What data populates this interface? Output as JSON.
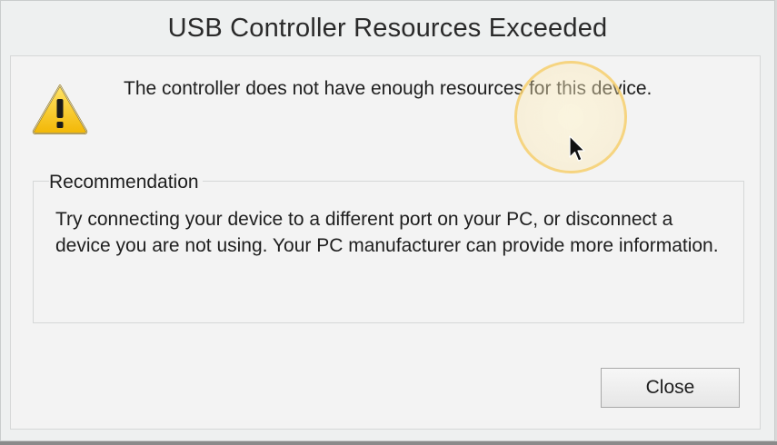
{
  "dialog": {
    "title": "USB Controller Resources Exceeded",
    "message": "The controller does not have enough resources for this device.",
    "recommendation": {
      "heading": "Recommendation",
      "body": "Try connecting your device to a different port on your PC, or disconnect a device you are not using. Your PC manufacturer can provide more information."
    },
    "close_label": "Close",
    "icon": "warning-icon"
  },
  "colors": {
    "background": "#eef0f0",
    "warning_yellow": "#f5c518",
    "cursor_highlight": "#f5cd69"
  }
}
